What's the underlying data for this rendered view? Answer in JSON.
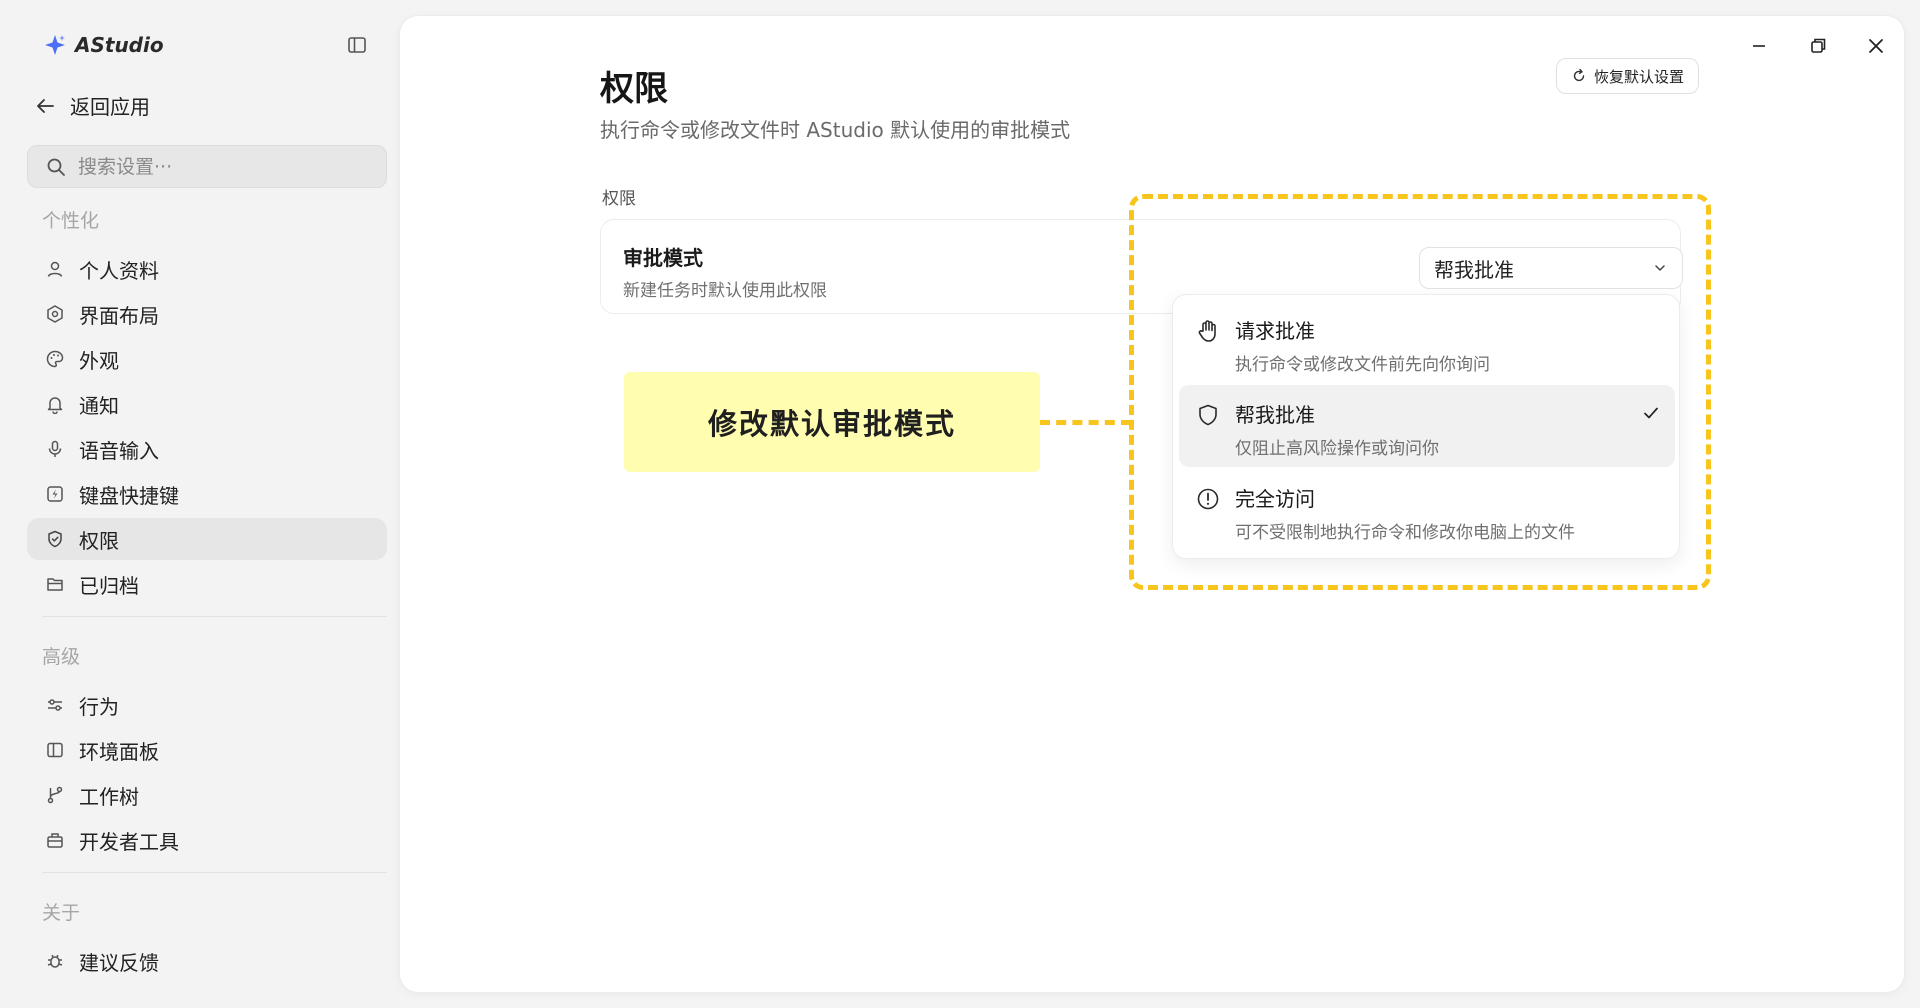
{
  "app": {
    "name": "AStudio",
    "accent": "#3b5bdb"
  },
  "sidebar": {
    "back_label": "返回应用",
    "search_placeholder": "搜索设置···",
    "sections": {
      "personal": "个性化",
      "advanced": "高级",
      "about": "关于"
    },
    "items": [
      {
        "label": "个人资料",
        "icon": "user-icon"
      },
      {
        "label": "界面布局",
        "icon": "layout-icon"
      },
      {
        "label": "外观",
        "icon": "palette-icon"
      },
      {
        "label": "通知",
        "icon": "bell-icon"
      },
      {
        "label": "语音输入",
        "icon": "microphone-icon"
      },
      {
        "label": "键盘快捷键",
        "icon": "lightning-icon"
      },
      {
        "label": "权限",
        "icon": "shield-icon",
        "active": true
      },
      {
        "label": "已归档",
        "icon": "archive-icon"
      },
      {
        "label": "行为",
        "icon": "sliders-icon"
      },
      {
        "label": "环境面板",
        "icon": "panel-icon"
      },
      {
        "label": "工作树",
        "icon": "branch-icon"
      },
      {
        "label": "开发者工具",
        "icon": "toolbox-icon"
      },
      {
        "label": "建议反馈",
        "icon": "bug-icon"
      }
    ]
  },
  "main": {
    "title": "权限",
    "subtitle": "执行命令或修改文件时 AStudio 默认使用的审批模式",
    "reset_label": "恢复默认设置",
    "group_label": "权限",
    "setting": {
      "title": "审批模式",
      "description": "新建任务时默认使用此权限",
      "selected_value": "帮我批准"
    },
    "dropdown_options": [
      {
        "title": "请求批准",
        "description": "执行命令或修改文件前先向你询问",
        "icon": "hand-icon",
        "selected": false
      },
      {
        "title": "帮我批准",
        "description": "仅阻止高风险操作或询问你",
        "icon": "shield-icon",
        "selected": true
      },
      {
        "title": "完全访问",
        "description": "可不受限制地执行命令和修改你电脑上的文件",
        "icon": "alert-circle-icon",
        "selected": false
      }
    ]
  },
  "annotation": {
    "callout_text": "修改默认审批模式",
    "highlight_color": "#f7c51c",
    "callout_bg": "#fffdb0"
  }
}
